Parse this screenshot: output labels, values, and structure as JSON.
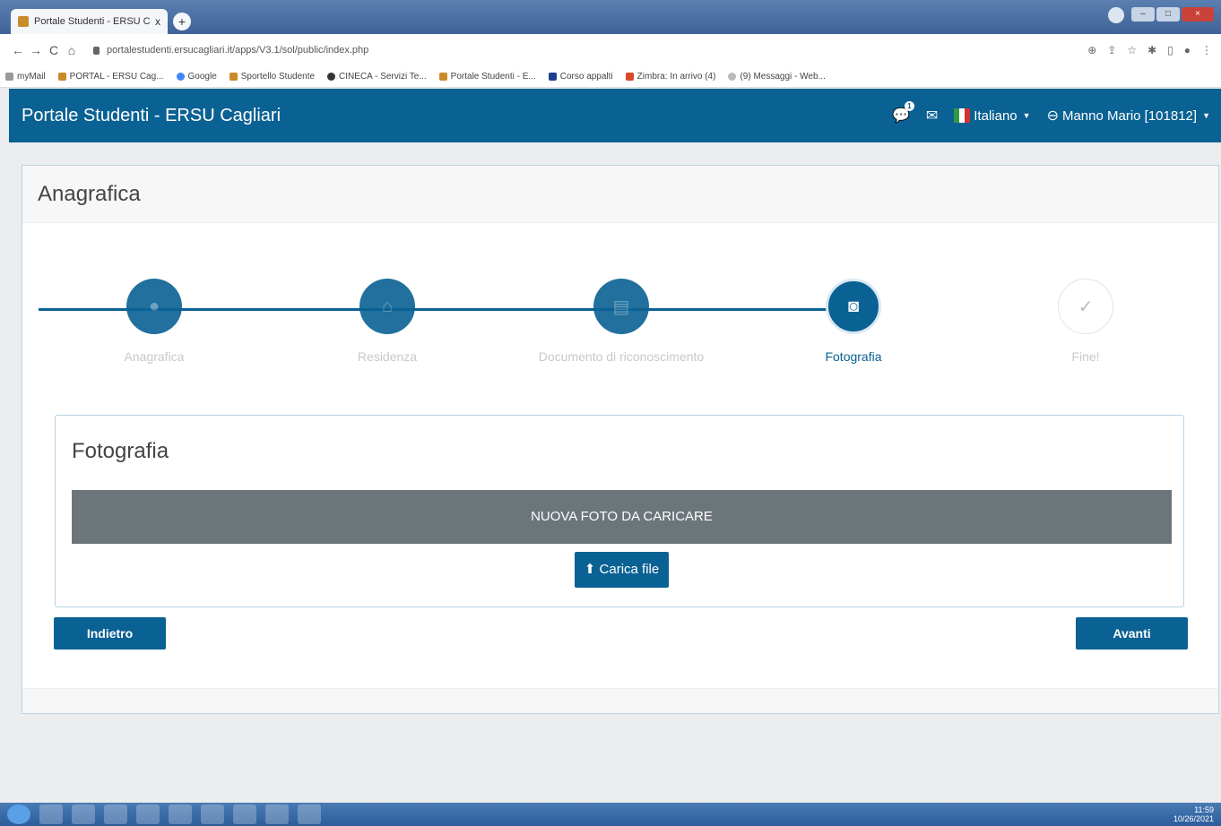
{
  "browser": {
    "tab_title": "Portale Studenti - ERSU Caglian",
    "tab_close": "x",
    "new_tab": "+",
    "url": "portalestudenti.ersucagliari.it/apps/V3.1/sol/public/index.php",
    "bookmarks": [
      "myMail",
      "PORTAL - ERSU Cag...",
      "Google",
      "Sportello Studente",
      "CINECA - Servizi Te...",
      "Portale Studenti - E...",
      "Corso appalti",
      "Zimbra: In arrivo (4)",
      "(9) Messaggi - Web..."
    ]
  },
  "navbar": {
    "brand": "Portale Studenti - ERSU Cagliari",
    "notification_count": "1",
    "language": "Italiano",
    "user": "Manno Mario [101812]"
  },
  "panel": {
    "title": "Anagrafica"
  },
  "steps": [
    {
      "label": "Anagrafica",
      "icon": "user-icon",
      "state": "done"
    },
    {
      "label": "Residenza",
      "icon": "home-icon",
      "state": "done"
    },
    {
      "label": "Documento di riconoscimento",
      "icon": "document-icon",
      "state": "done"
    },
    {
      "label": "Fotografia",
      "icon": "camera-icon",
      "state": "active"
    },
    {
      "label": "Fine!",
      "icon": "check-icon",
      "state": "todo"
    }
  ],
  "photo_card": {
    "title": "Fotografia",
    "bar_text": "NUOVA FOTO DA CARICARE",
    "upload_label": "Carica file"
  },
  "buttons": {
    "back": "Indietro",
    "next": "Avanti"
  },
  "taskbar": {
    "time": "11:59",
    "date": "10/26/2021"
  },
  "colors": {
    "brand": "#0a6193",
    "bar_gray": "#6c757a"
  }
}
